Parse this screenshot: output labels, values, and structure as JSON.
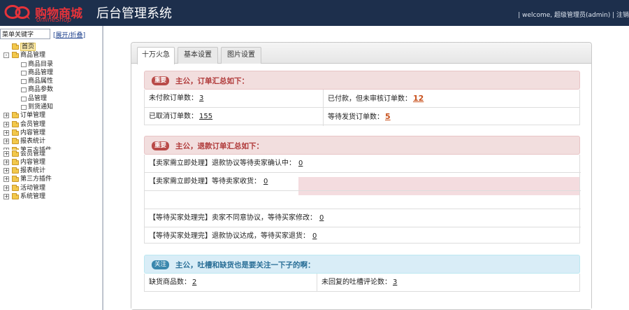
{
  "header": {
    "logo_cn": "购物商城",
    "logo_en": "onlineShop",
    "system_title": "后台管理系统",
    "welcome": "| welcome, 超级管理员(admin) | 注销"
  },
  "sidebar": {
    "search_placeholder": "菜单关键字",
    "expand_link_left": "[",
    "expand_link_text": "展开/折叠",
    "expand_link_right": "]",
    "tree": [
      {
        "label": "首页",
        "type": "home"
      },
      {
        "label": "商品管理",
        "type": "folder",
        "pm": "-"
      },
      {
        "label": "商品目录",
        "type": "child"
      },
      {
        "label": "商品管理",
        "type": "child"
      },
      {
        "label": "商品属性",
        "type": "child"
      },
      {
        "label": "商品参数",
        "type": "child"
      },
      {
        "label": "品管理",
        "type": "child"
      },
      {
        "label": "到货通知",
        "type": "child"
      },
      {
        "label": "订单管理",
        "type": "folder",
        "pm": "+"
      },
      {
        "label": "会员管理",
        "type": "folder",
        "pm": "+"
      },
      {
        "label": "内容管理",
        "type": "folder",
        "pm": "+"
      },
      {
        "label": "报表统计",
        "type": "folder",
        "pm": "+"
      },
      {
        "label": "第三方插件",
        "type": "cut",
        "pm": "+"
      },
      {
        "label": "会员管理",
        "type": "folder",
        "pm": "+"
      },
      {
        "label": "内容管理",
        "type": "folder",
        "pm": "+"
      },
      {
        "label": "报表统计",
        "type": "folder",
        "pm": "+"
      },
      {
        "label": "第三方插件",
        "type": "folder",
        "pm": "+"
      },
      {
        "label": "活动管理",
        "type": "folder",
        "pm": "+"
      },
      {
        "label": "系统管理",
        "type": "folder",
        "pm": "+"
      }
    ]
  },
  "tabs": [
    {
      "label": "十万火急",
      "active": true
    },
    {
      "label": "基本设置",
      "active": false
    },
    {
      "label": "图片设置",
      "active": false
    }
  ],
  "section1": {
    "badge": "重要",
    "title": "主公，订单汇总如下：",
    "cells": [
      {
        "label": "未付款订单数：",
        "value": "3",
        "highlight": false
      },
      {
        "label": "已付款，但未审核订单数：",
        "value": "12",
        "highlight": true
      },
      {
        "label": "已取消订单数：",
        "value": "155",
        "highlight": false
      },
      {
        "label": "等待发货订单数：",
        "value": "5",
        "highlight": true
      }
    ]
  },
  "section2": {
    "badge": "重要",
    "title": "主公，退款订单汇总如下：",
    "rows": [
      {
        "label": "【卖家需立即处理】退款协议等待卖家确认中：",
        "value": "0"
      },
      {
        "label": "【卖家需立即处理】等待卖家收货：",
        "value": "0"
      },
      {
        "label": "",
        "value": ""
      },
      {
        "label": "【等待买家处理完】卖家不同意协议，等待买家修改：",
        "value": "0"
      },
      {
        "label": "【等待买家处理完】退款协议达成，等待买家退货：",
        "value": "0"
      }
    ]
  },
  "section3": {
    "badge": "关注",
    "title": "主公，吐槽和缺货也是要关注一下子的啊：",
    "cells": [
      {
        "label": "缺货商品数：",
        "value": "2"
      },
      {
        "label": "未回复的吐槽评论数：",
        "value": "3"
      }
    ]
  },
  "colors": {
    "header_bg": "#1d2f4c",
    "logo_red": "#e6333a",
    "danger_bg": "#f2dede",
    "danger_badge": "#b94a48",
    "info_bg": "#d9edf7",
    "info_badge": "#3a87ad",
    "highlight_value": "#c8501b"
  }
}
